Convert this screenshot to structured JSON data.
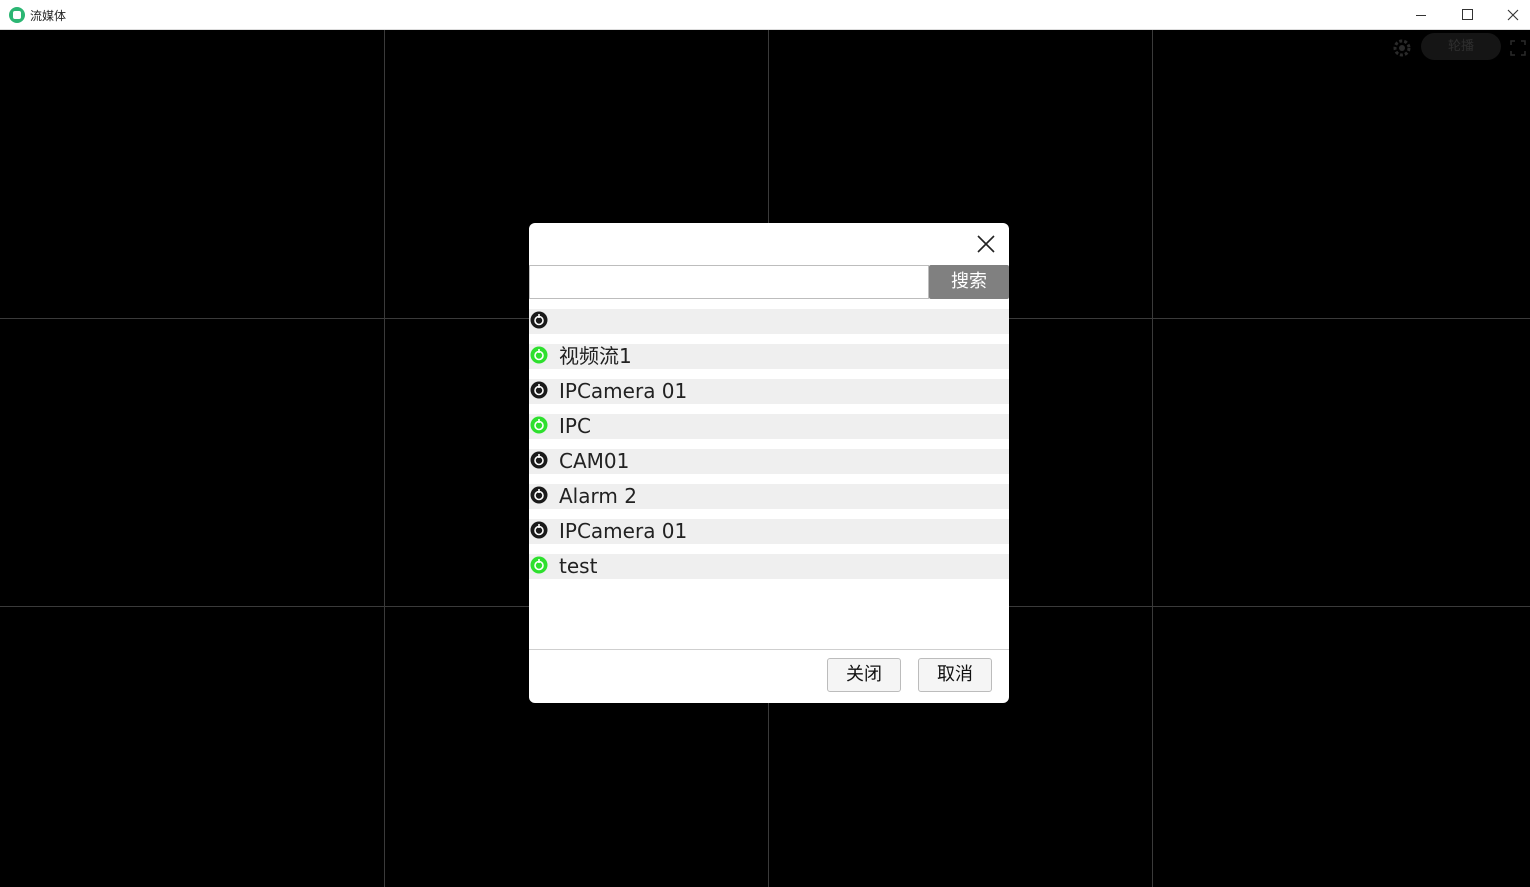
{
  "window": {
    "title": "流媒体",
    "icon": "app-logo-icon"
  },
  "toolbar": {
    "pill_label": "轮播",
    "settings_icon": "gear-icon",
    "fullscreen_icon": "fullscreen-icon"
  },
  "dialog": {
    "search": {
      "value": "",
      "placeholder": ""
    },
    "search_label": "搜索",
    "streams": [
      {
        "label": "",
        "status": "offline"
      },
      {
        "label": "视频流1",
        "status": "online"
      },
      {
        "label": "IPCamera 01",
        "status": "offline"
      },
      {
        "label": "IPC",
        "status": "online"
      },
      {
        "label": "CAM01",
        "status": "offline"
      },
      {
        "label": "Alarm 2",
        "status": "offline"
      },
      {
        "label": "IPCamera 01",
        "status": "offline"
      },
      {
        "label": "test",
        "status": "online"
      }
    ],
    "close_label": "关闭",
    "cancel_label": "取消"
  },
  "colors": {
    "online": "#2ee02e",
    "offline": "#1a1a1a",
    "search_button": "#808080",
    "background": "#000000"
  }
}
